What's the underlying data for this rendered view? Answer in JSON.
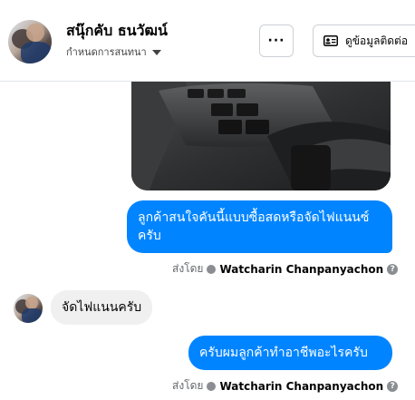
{
  "header": {
    "name": "สนุ๊กคับ ธนวัฒน์",
    "subtitle": "กำหนดการสนทนา",
    "more_label": "···",
    "contact_label": "ดูข้อมูลติดต่อ"
  },
  "messages": [
    {
      "type": "image",
      "from": "me"
    },
    {
      "type": "text",
      "from": "me",
      "text": "ลูกค้าสนใจคันนี้แบบซื้อสดหรือจัดไฟแนนซ์ครับ"
    },
    {
      "type": "sent_by",
      "prefix": "ส่งโดย",
      "name": "Watcharin Chanpanyachon"
    },
    {
      "type": "text",
      "from": "customer",
      "text": "จัดไฟแนนครับ"
    },
    {
      "type": "text",
      "from": "me",
      "text": "ครับผมลูกค้าทำอาชีพอะไรครับ"
    },
    {
      "type": "sent_by",
      "prefix": "ส่งโดย",
      "name": "Watcharin Chanpanyachon"
    }
  ],
  "colors": {
    "outgoing": "#0084ff",
    "incoming": "#f0f0f0"
  },
  "icons": {
    "more": "more-icon",
    "contact": "contact-card-icon",
    "verified": "verified-icon",
    "help": "help-icon"
  }
}
